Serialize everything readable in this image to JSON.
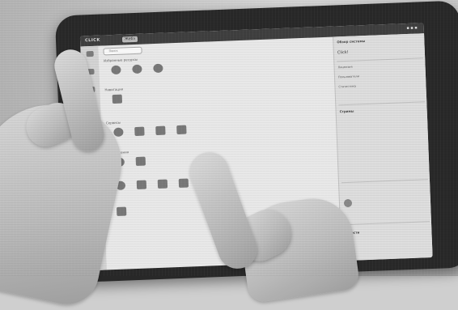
{
  "topbar": {
    "brand": "CLICK",
    "tag": "Жебэ"
  },
  "search": {
    "placeholder": "Поиск"
  },
  "sections": {
    "favorites": "Избранные ресурсы",
    "navigation": "Навигация",
    "services": "Сервисы",
    "apps": "Приложения"
  },
  "right_panel": {
    "title": "Click!",
    "header": "Обзор системы",
    "stream": "Стримы",
    "labels": [
      "Лицензия",
      "Пользователи",
      "Статистика"
    ],
    "bottom": "Новости"
  }
}
